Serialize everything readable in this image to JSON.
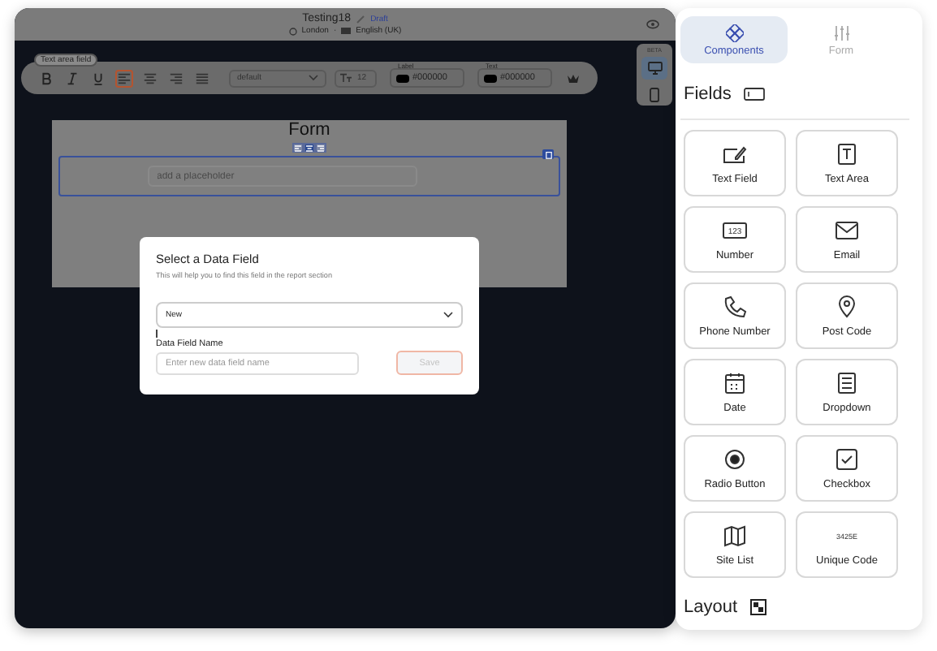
{
  "header": {
    "title": "Testing18",
    "status": "Draft",
    "location": "London",
    "separator": "·",
    "language": "English (UK)"
  },
  "toolbar": {
    "tag": "Text area field",
    "buttons": [
      {
        "kind": "bold",
        "selected": false
      },
      {
        "kind": "italic",
        "selected": false
      },
      {
        "kind": "underline",
        "selected": false
      },
      {
        "kind": "align-left",
        "selected": true
      },
      {
        "kind": "align-center",
        "selected": false
      },
      {
        "kind": "align-right",
        "selected": false
      },
      {
        "kind": "justify",
        "selected": false
      }
    ],
    "font": "default",
    "font_size": "12",
    "label_color": {
      "caption": "Label",
      "value": "#000000",
      "color": "#000000"
    },
    "text_color": {
      "caption": "Text",
      "value": "#000000",
      "color": "#000000"
    }
  },
  "devices": {
    "badge": "BETA",
    "items": [
      {
        "kind": "desktop",
        "selected": true
      },
      {
        "kind": "mobile",
        "selected": false
      }
    ]
  },
  "canvas": {
    "title": "Form",
    "align": [
      {
        "kind": "left",
        "selected": false
      },
      {
        "kind": "center",
        "selected": true
      },
      {
        "kind": "right",
        "selected": false
      }
    ],
    "placeholder": "add a placeholder"
  },
  "dialog": {
    "title": "Select a Data Field",
    "subtitle": "This will help you to find this field in the report section",
    "select": "New",
    "field_label": "Data Field Name",
    "placeholder": "Enter new data field name",
    "save": "Save",
    "save_disabled": true
  },
  "tabs": [
    {
      "label": "Components",
      "kind": "components",
      "selected": true
    },
    {
      "label": "Form",
      "kind": "form",
      "selected": false
    }
  ],
  "fields_heading": "Fields",
  "fields": [
    {
      "label": "Text Field",
      "kind": "text-field"
    },
    {
      "label": "Text Area",
      "kind": "text-area"
    },
    {
      "label": "Number",
      "kind": "number"
    },
    {
      "label": "Email",
      "kind": "email"
    },
    {
      "label": "Phone Number",
      "kind": "phone"
    },
    {
      "label": "Post Code",
      "kind": "pin"
    },
    {
      "label": "Date",
      "kind": "date"
    },
    {
      "label": "Dropdown",
      "kind": "dropdown"
    },
    {
      "label": "Radio Button",
      "kind": "radio"
    },
    {
      "label": "Checkbox",
      "kind": "checkbox"
    },
    {
      "label": "Site List",
      "kind": "map"
    },
    {
      "label": "Unique Code",
      "kind": "code"
    }
  ],
  "icon_texts": {
    "number": "123",
    "code": "3425E"
  },
  "layout_heading": "Layout"
}
